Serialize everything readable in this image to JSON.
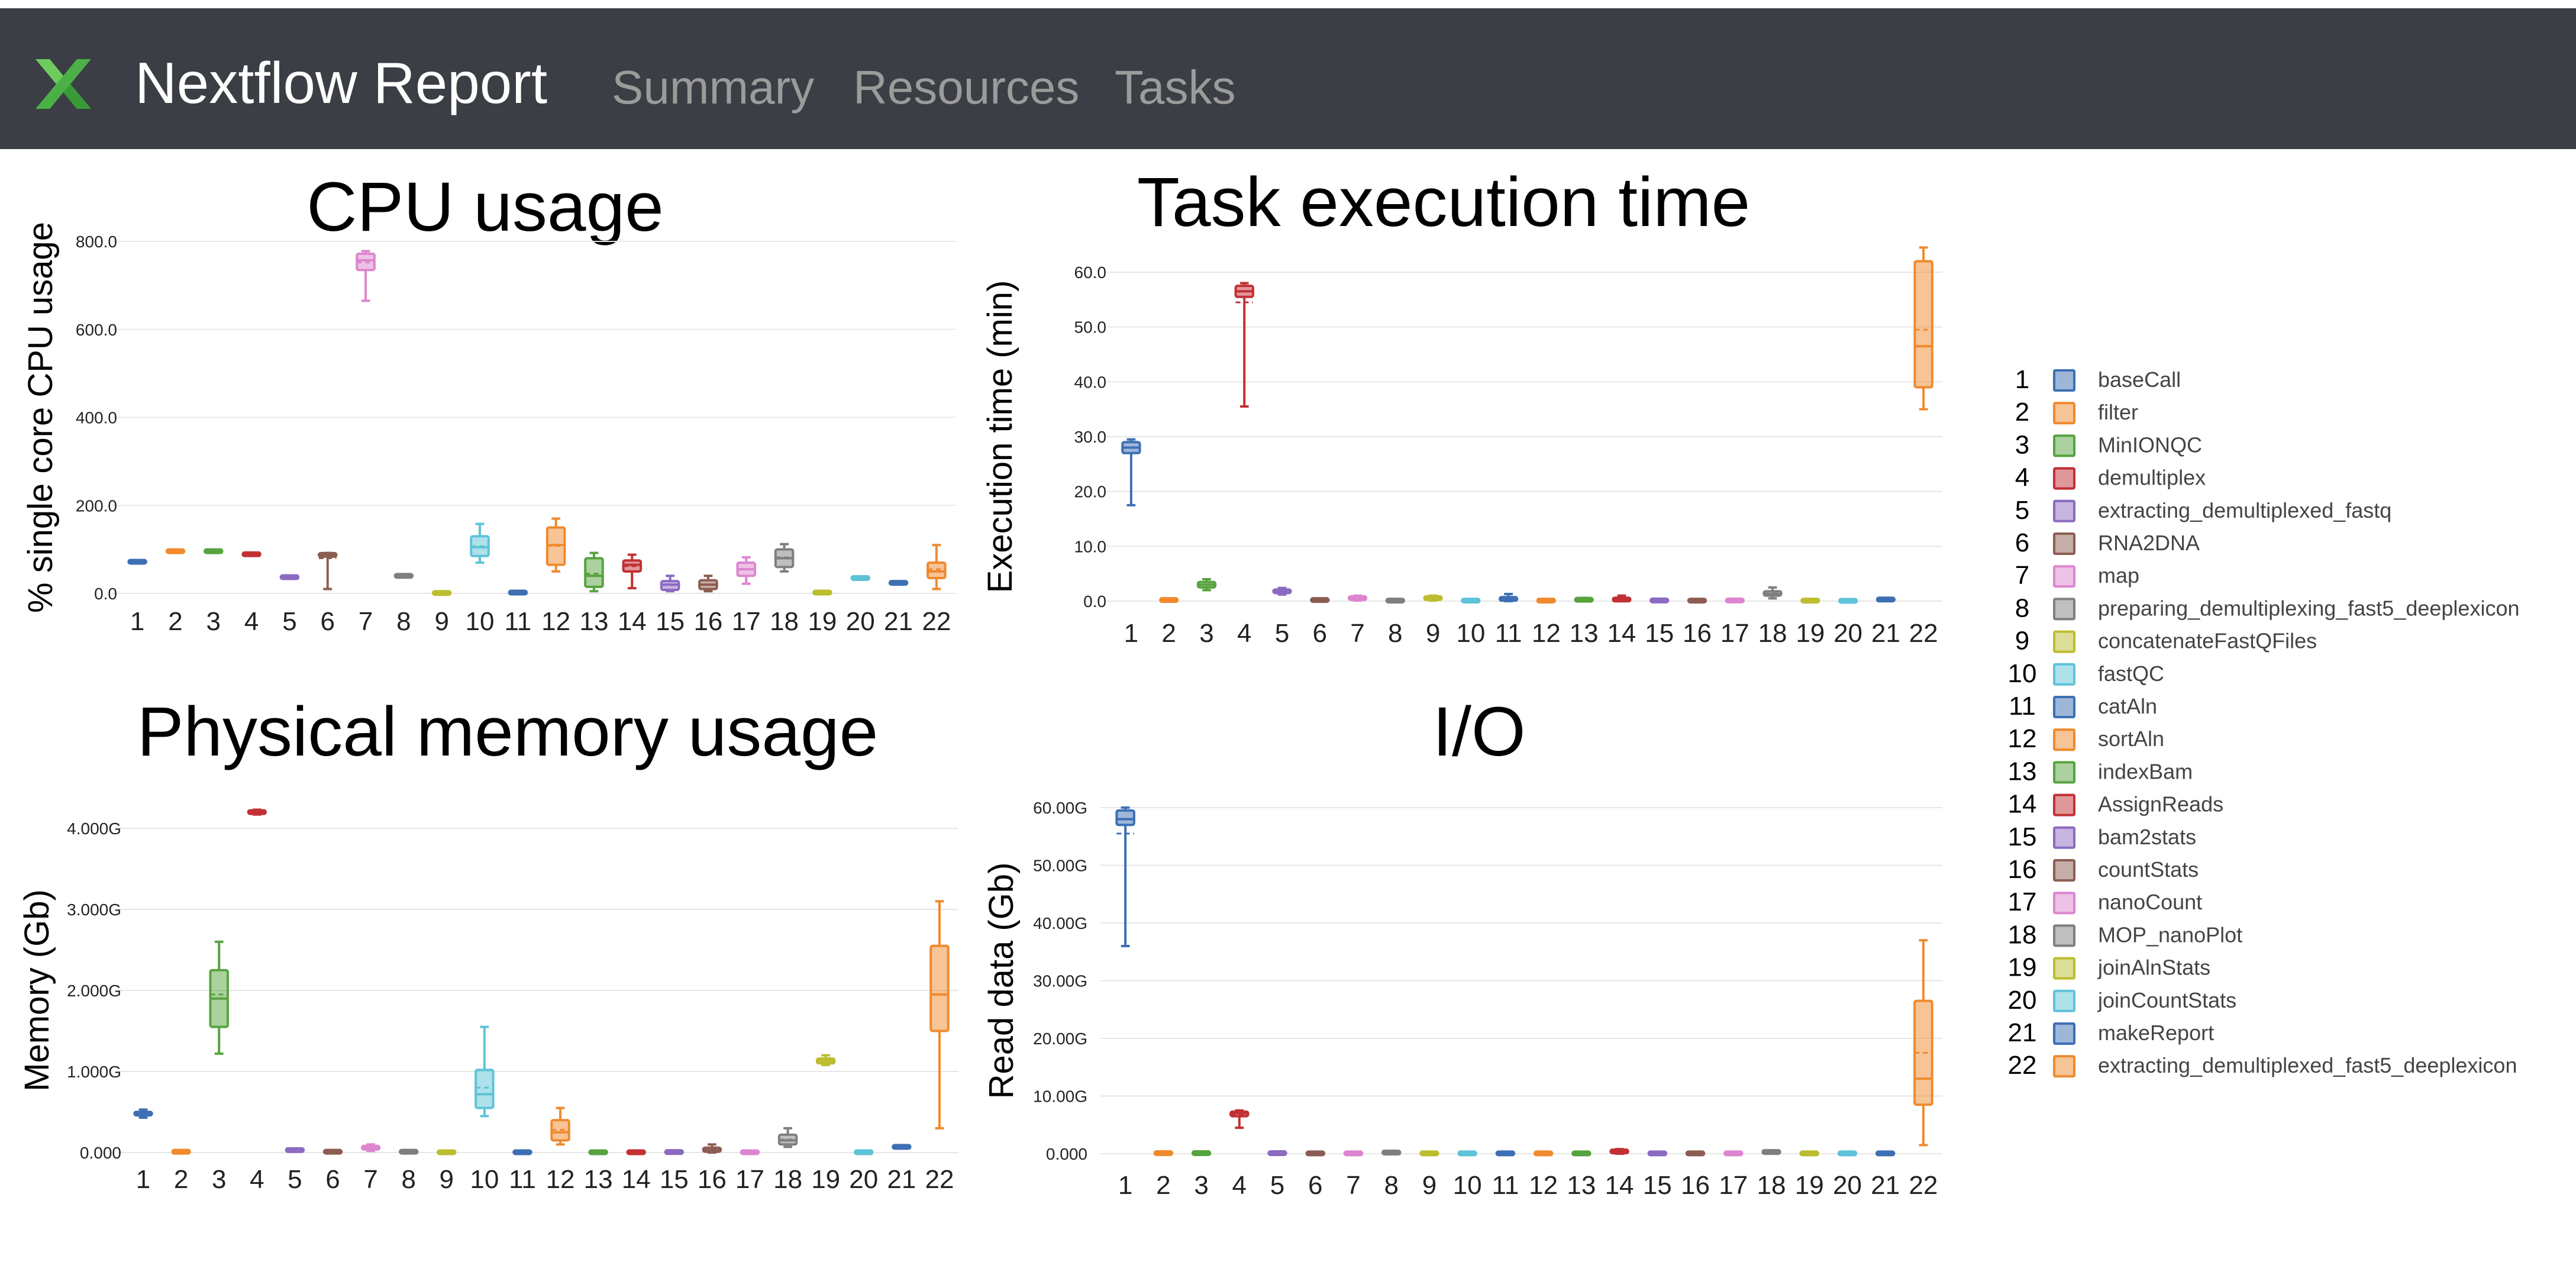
{
  "app": {
    "title": "Nextflow Report",
    "nav": [
      {
        "label": "Summary"
      },
      {
        "label": "Resources"
      },
      {
        "label": "Tasks"
      }
    ],
    "brand_color": "#4cb748",
    "navbar_color": "#3b3e44"
  },
  "legend": {
    "placement": "right",
    "items": [
      {
        "num": "1",
        "label": "baseCall",
        "color": "#3e6fb4"
      },
      {
        "num": "2",
        "label": "filter",
        "color": "#ef8a2e"
      },
      {
        "num": "3",
        "label": "MinIONQC",
        "color": "#57a33f"
      },
      {
        "num": "4",
        "label": "demultiplex",
        "color": "#c23034"
      },
      {
        "num": "5",
        "label": "extracting_demultiplexed_fastq",
        "color": "#8b6bc1"
      },
      {
        "num": "6",
        "label": "RNA2DNA",
        "color": "#8c5d52"
      },
      {
        "num": "7",
        "label": "map",
        "color": "#dd85cf"
      },
      {
        "num": "8",
        "label": "preparing_demultiplexing_fast5_deeplexicon",
        "color": "#7f7f7f"
      },
      {
        "num": "9",
        "label": "concatenateFastQFiles",
        "color": "#bcbd2f"
      },
      {
        "num": "10",
        "label": "fastQC",
        "color": "#5ec3d8"
      },
      {
        "num": "11",
        "label": "catAln",
        "color": "#3e6fb4"
      },
      {
        "num": "12",
        "label": "sortAln",
        "color": "#ef8a2e"
      },
      {
        "num": "13",
        "label": "indexBam",
        "color": "#57a33f"
      },
      {
        "num": "14",
        "label": "AssignReads",
        "color": "#c23034"
      },
      {
        "num": "15",
        "label": "bam2stats",
        "color": "#8b6bc1"
      },
      {
        "num": "16",
        "label": "countStats",
        "color": "#8c5d52"
      },
      {
        "num": "17",
        "label": "nanoCount",
        "color": "#dd85cf"
      },
      {
        "num": "18",
        "label": "MOP_nanoPlot",
        "color": "#7f7f7f"
      },
      {
        "num": "19",
        "label": "joinAlnStats",
        "color": "#bcbd2f"
      },
      {
        "num": "20",
        "label": "joinCountStats",
        "color": "#5ec3d8"
      },
      {
        "num": "21",
        "label": "makeReport",
        "color": "#3e6fb4"
      },
      {
        "num": "22",
        "label": "extracting_demultiplexed_fast5_deeplexicon",
        "color": "#ef8a2e"
      }
    ]
  },
  "chart_data": [
    {
      "id": "cpu",
      "type": "box",
      "title": "CPU usage",
      "ylabel": "% single core CPU usage",
      "ylim": [
        0,
        850
      ],
      "yticks": [
        0,
        200,
        400,
        600,
        800
      ],
      "yticklabels": [
        "0.0",
        "200.0",
        "400.0",
        "600.0",
        "800.0"
      ],
      "categories": [
        "1",
        "2",
        "3",
        "4",
        "5",
        "6",
        "7",
        "8",
        "9",
        "10",
        "11",
        "12",
        "13",
        "14",
        "15",
        "16",
        "17",
        "18",
        "19",
        "20",
        "21",
        "22"
      ],
      "boxes": [
        {
          "min": 68,
          "q1": 70,
          "median": 72,
          "q3": 74,
          "max": 76,
          "mean": 72
        },
        {
          "min": 94,
          "q1": 95,
          "median": 96,
          "q3": 97,
          "max": 98,
          "mean": 96
        },
        {
          "min": 94,
          "q1": 95,
          "median": 96,
          "q3": 97,
          "max": 98,
          "mean": 96
        },
        {
          "min": 87,
          "q1": 88,
          "median": 89,
          "q3": 90,
          "max": 91,
          "mean": 89
        },
        {
          "min": 34,
          "q1": 35,
          "median": 37,
          "q3": 39,
          "max": 40,
          "mean": 37
        },
        {
          "min": 10,
          "q1": 85,
          "median": 88,
          "q3": 90,
          "max": 92,
          "mean": 80
        },
        {
          "min": 665,
          "q1": 735,
          "median": 757,
          "q3": 772,
          "max": 778,
          "mean": 752
        },
        {
          "min": 38,
          "q1": 39,
          "median": 40,
          "q3": 41,
          "max": 42,
          "mean": 40
        },
        {
          "min": 0,
          "q1": 0,
          "median": 1,
          "q3": 2,
          "max": 3,
          "mean": 1
        },
        {
          "min": 70,
          "q1": 85,
          "median": 105,
          "q3": 130,
          "max": 158,
          "mean": 107
        },
        {
          "min": 0,
          "q1": 1,
          "median": 2,
          "q3": 3,
          "max": 4,
          "mean": 2
        },
        {
          "min": 50,
          "q1": 65,
          "median": 110,
          "q3": 150,
          "max": 170,
          "mean": 108
        },
        {
          "min": 5,
          "q1": 15,
          "median": 40,
          "q3": 80,
          "max": 92,
          "mean": 45
        },
        {
          "min": 12,
          "q1": 50,
          "median": 65,
          "q3": 75,
          "max": 88,
          "mean": 62
        },
        {
          "min": 5,
          "q1": 8,
          "median": 20,
          "q3": 28,
          "max": 40,
          "mean": 19
        },
        {
          "min": 5,
          "q1": 10,
          "median": 20,
          "q3": 30,
          "max": 40,
          "mean": 20
        },
        {
          "min": 22,
          "q1": 40,
          "median": 55,
          "q3": 70,
          "max": 82,
          "mean": 55
        },
        {
          "min": 50,
          "q1": 60,
          "median": 80,
          "q3": 100,
          "max": 112,
          "mean": 82
        },
        {
          "min": 0,
          "q1": 1,
          "median": 2,
          "q3": 3,
          "max": 4,
          "mean": 2
        },
        {
          "min": 33,
          "q1": 34,
          "median": 35,
          "q3": 36,
          "max": 37,
          "mean": 35
        },
        {
          "min": 22,
          "q1": 23,
          "median": 24,
          "q3": 25,
          "max": 26,
          "mean": 24
        },
        {
          "min": 10,
          "q1": 35,
          "median": 50,
          "q3": 70,
          "max": 110,
          "mean": 55
        }
      ]
    },
    {
      "id": "time",
      "type": "box",
      "title": "Task execution time",
      "ylabel": "Execution time (min)",
      "ylim": [
        0,
        65
      ],
      "yticks": [
        0,
        10,
        20,
        30,
        40,
        50,
        60
      ],
      "yticklabels": [
        "0.0",
        "10.0",
        "20.0",
        "30.0",
        "40.0",
        "50.0",
        "60.0"
      ],
      "categories": [
        "1",
        "2",
        "3",
        "4",
        "5",
        "6",
        "7",
        "8",
        "9",
        "10",
        "11",
        "12",
        "13",
        "14",
        "15",
        "16",
        "17",
        "18",
        "19",
        "20",
        "21",
        "22"
      ],
      "boxes": [
        {
          "min": 17.5,
          "q1": 27,
          "median": 28,
          "q3": 29,
          "max": 29.5,
          "mean": 27
        },
        {
          "min": 0,
          "q1": 0.1,
          "median": 0.2,
          "q3": 0.3,
          "max": 0.4,
          "mean": 0.2
        },
        {
          "min": 2,
          "q1": 2.5,
          "median": 3,
          "q3": 3.5,
          "max": 4,
          "mean": 3
        },
        {
          "min": 35.5,
          "q1": 55.5,
          "median": 56.5,
          "q3": 57.5,
          "max": 58,
          "mean": 54.5
        },
        {
          "min": 1.2,
          "q1": 1.5,
          "median": 1.8,
          "q3": 2.1,
          "max": 2.4,
          "mean": 1.8
        },
        {
          "min": 0,
          "q1": 0.1,
          "median": 0.2,
          "q3": 0.3,
          "max": 0.4,
          "mean": 0.2
        },
        {
          "min": 0.1,
          "q1": 0.3,
          "median": 0.5,
          "q3": 0.8,
          "max": 1,
          "mean": 0.5
        },
        {
          "min": 0,
          "q1": 0.05,
          "median": 0.1,
          "q3": 0.15,
          "max": 0.2,
          "mean": 0.1
        },
        {
          "min": 0.1,
          "q1": 0.3,
          "median": 0.5,
          "q3": 0.8,
          "max": 1,
          "mean": 0.5
        },
        {
          "min": 0,
          "q1": 0.05,
          "median": 0.1,
          "q3": 0.15,
          "max": 0.2,
          "mean": 0.1
        },
        {
          "min": 0,
          "q1": 0.1,
          "median": 0.3,
          "q3": 0.7,
          "max": 1.3,
          "mean": 0.4
        },
        {
          "min": 0,
          "q1": 0.05,
          "median": 0.1,
          "q3": 0.15,
          "max": 0.2,
          "mean": 0.1
        },
        {
          "min": 0,
          "q1": 0.1,
          "median": 0.2,
          "q3": 0.4,
          "max": 0.6,
          "mean": 0.2
        },
        {
          "min": 0,
          "q1": 0.1,
          "median": 0.2,
          "q3": 0.5,
          "max": 1,
          "mean": 0.3
        },
        {
          "min": 0,
          "q1": 0.05,
          "median": 0.1,
          "q3": 0.2,
          "max": 0.3,
          "mean": 0.1
        },
        {
          "min": 0,
          "q1": 0.05,
          "median": 0.1,
          "q3": 0.15,
          "max": 0.2,
          "mean": 0.1
        },
        {
          "min": 0,
          "q1": 0.05,
          "median": 0.1,
          "q3": 0.2,
          "max": 0.3,
          "mean": 0.1
        },
        {
          "min": 0.5,
          "q1": 1,
          "median": 1.3,
          "q3": 1.8,
          "max": 2.5,
          "mean": 1.4
        },
        {
          "min": 0,
          "q1": 0.05,
          "median": 0.1,
          "q3": 0.15,
          "max": 0.2,
          "mean": 0.1
        },
        {
          "min": 0,
          "q1": 0.03,
          "median": 0.05,
          "q3": 0.08,
          "max": 0.1,
          "mean": 0.05
        },
        {
          "min": 0.1,
          "q1": 0.2,
          "median": 0.3,
          "q3": 0.4,
          "max": 0.5,
          "mean": 0.3
        },
        {
          "min": 35,
          "q1": 39,
          "median": 46.5,
          "q3": 62,
          "max": 64.5,
          "mean": 49.5
        }
      ]
    },
    {
      "id": "memory",
      "type": "box",
      "title": "Physical memory usage",
      "ylabel": "Memory (Gb)",
      "ylim": [
        0,
        4.5
      ],
      "yticks": [
        0,
        1,
        2,
        3,
        4
      ],
      "yticklabels": [
        "0.000",
        "1.000G",
        "2.000G",
        "3.000G",
        "4.000G"
      ],
      "categories": [
        "1",
        "2",
        "3",
        "4",
        "5",
        "6",
        "7",
        "8",
        "9",
        "10",
        "11",
        "12",
        "13",
        "14",
        "15",
        "16",
        "17",
        "18",
        "19",
        "20",
        "21",
        "22"
      ],
      "boxes": [
        {
          "min": 0.43,
          "q1": 0.46,
          "median": 0.48,
          "q3": 0.5,
          "max": 0.53,
          "mean": 0.48
        },
        {
          "min": 0,
          "q1": 0.005,
          "median": 0.01,
          "q3": 0.015,
          "max": 0.02,
          "mean": 0.01
        },
        {
          "min": 1.22,
          "q1": 1.55,
          "median": 1.9,
          "q3": 2.25,
          "max": 2.6,
          "mean": 1.95
        },
        {
          "min": 4.17,
          "q1": 4.19,
          "median": 4.2,
          "q3": 4.21,
          "max": 4.23,
          "mean": 4.2
        },
        {
          "min": 0.01,
          "q1": 0.02,
          "median": 0.03,
          "q3": 0.04,
          "max": 0.05,
          "mean": 0.03
        },
        {
          "min": 0,
          "q1": 0.005,
          "median": 0.01,
          "q3": 0.015,
          "max": 0.02,
          "mean": 0.01
        },
        {
          "min": 0.02,
          "q1": 0.04,
          "median": 0.06,
          "q3": 0.08,
          "max": 0.1,
          "mean": 0.06
        },
        {
          "min": 0,
          "q1": 0.005,
          "median": 0.01,
          "q3": 0.015,
          "max": 0.02,
          "mean": 0.01
        },
        {
          "min": 0,
          "q1": 0.002,
          "median": 0.004,
          "q3": 0.006,
          "max": 0.008,
          "mean": 0.004
        },
        {
          "min": 0.45,
          "q1": 0.55,
          "median": 0.72,
          "q3": 1.02,
          "max": 1.55,
          "mean": 0.8
        },
        {
          "min": 0,
          "q1": 0.002,
          "median": 0.004,
          "q3": 0.006,
          "max": 0.008,
          "mean": 0.004
        },
        {
          "min": 0.1,
          "q1": 0.15,
          "median": 0.25,
          "q3": 0.4,
          "max": 0.55,
          "mean": 0.28
        },
        {
          "min": 0,
          "q1": 0.002,
          "median": 0.004,
          "q3": 0.006,
          "max": 0.008,
          "mean": 0.004
        },
        {
          "min": 0,
          "q1": 0.002,
          "median": 0.004,
          "q3": 0.006,
          "max": 0.008,
          "mean": 0.004
        },
        {
          "min": 0,
          "q1": 0.003,
          "median": 0.006,
          "q3": 0.009,
          "max": 0.012,
          "mean": 0.006
        },
        {
          "min": 0,
          "q1": 0.01,
          "median": 0.03,
          "q3": 0.06,
          "max": 0.1,
          "mean": 0.04
        },
        {
          "min": 0,
          "q1": 0.002,
          "median": 0.004,
          "q3": 0.006,
          "max": 0.008,
          "mean": 0.004
        },
        {
          "min": 0.07,
          "q1": 0.1,
          "median": 0.15,
          "q3": 0.22,
          "max": 0.3,
          "mean": 0.16
        },
        {
          "min": 1.08,
          "q1": 1.1,
          "median": 1.13,
          "q3": 1.16,
          "max": 1.2,
          "mean": 1.13
        },
        {
          "min": 0,
          "q1": 0.002,
          "median": 0.004,
          "q3": 0.006,
          "max": 0.008,
          "mean": 0.004
        },
        {
          "min": 0.05,
          "q1": 0.06,
          "median": 0.07,
          "q3": 0.08,
          "max": 0.09,
          "mean": 0.07
        },
        {
          "min": 0.3,
          "q1": 1.5,
          "median": 1.95,
          "q3": 2.55,
          "max": 3.1,
          "mean": 1.95
        }
      ]
    },
    {
      "id": "io",
      "type": "box",
      "title": "I/O",
      "ylabel": "Read data (Gb)",
      "ylim": [
        0,
        62
      ],
      "yticks": [
        0,
        10,
        20,
        30,
        40,
        50,
        60
      ],
      "yticklabels": [
        "0.000",
        "10.00G",
        "20.00G",
        "30.00G",
        "40.00G",
        "50.00G",
        "60.00G"
      ],
      "categories": [
        "1",
        "2",
        "3",
        "4",
        "5",
        "6",
        "7",
        "8",
        "9",
        "10",
        "11",
        "12",
        "13",
        "14",
        "15",
        "16",
        "17",
        "18",
        "19",
        "20",
        "21",
        "22"
      ],
      "boxes": [
        {
          "min": 36,
          "q1": 57,
          "median": 58,
          "q3": 59.5,
          "max": 60,
          "mean": 55.5
        },
        {
          "min": 0,
          "q1": 0.05,
          "median": 0.1,
          "q3": 0.15,
          "max": 0.2,
          "mean": 0.1
        },
        {
          "min": 0,
          "q1": 0.05,
          "median": 0.1,
          "q3": 0.15,
          "max": 0.2,
          "mean": 0.1
        },
        {
          "min": 4.5,
          "q1": 6.5,
          "median": 7,
          "q3": 7.3,
          "max": 7.5,
          "mean": 6.8
        },
        {
          "min": 0,
          "q1": 0.05,
          "median": 0.1,
          "q3": 0.15,
          "max": 0.2,
          "mean": 0.1
        },
        {
          "min": 0,
          "q1": 0.03,
          "median": 0.06,
          "q3": 0.09,
          "max": 0.12,
          "mean": 0.06
        },
        {
          "min": 0,
          "q1": 0.03,
          "median": 0.06,
          "q3": 0.09,
          "max": 0.12,
          "mean": 0.06
        },
        {
          "min": 0,
          "q1": 0.1,
          "median": 0.2,
          "q3": 0.3,
          "max": 0.4,
          "mean": 0.2
        },
        {
          "min": 0,
          "q1": 0.03,
          "median": 0.06,
          "q3": 0.09,
          "max": 0.12,
          "mean": 0.06
        },
        {
          "min": 0,
          "q1": 0.03,
          "median": 0.06,
          "q3": 0.09,
          "max": 0.12,
          "mean": 0.06
        },
        {
          "min": 0,
          "q1": 0.03,
          "median": 0.06,
          "q3": 0.09,
          "max": 0.12,
          "mean": 0.06
        },
        {
          "min": 0,
          "q1": 0.03,
          "median": 0.06,
          "q3": 0.09,
          "max": 0.12,
          "mean": 0.06
        },
        {
          "min": 0,
          "q1": 0.03,
          "median": 0.06,
          "q3": 0.09,
          "max": 0.12,
          "mean": 0.06
        },
        {
          "min": 0,
          "q1": 0.2,
          "median": 0.4,
          "q3": 0.6,
          "max": 0.8,
          "mean": 0.4
        },
        {
          "min": 0,
          "q1": 0.03,
          "median": 0.06,
          "q3": 0.09,
          "max": 0.12,
          "mean": 0.06
        },
        {
          "min": 0,
          "q1": 0.03,
          "median": 0.06,
          "q3": 0.09,
          "max": 0.12,
          "mean": 0.06
        },
        {
          "min": 0,
          "q1": 0.03,
          "median": 0.06,
          "q3": 0.09,
          "max": 0.12,
          "mean": 0.06
        },
        {
          "min": 0,
          "q1": 0.15,
          "median": 0.3,
          "q3": 0.45,
          "max": 0.6,
          "mean": 0.3
        },
        {
          "min": 0,
          "q1": 0.03,
          "median": 0.06,
          "q3": 0.09,
          "max": 0.12,
          "mean": 0.06
        },
        {
          "min": 0,
          "q1": 0.03,
          "median": 0.06,
          "q3": 0.09,
          "max": 0.12,
          "mean": 0.06
        },
        {
          "min": 0,
          "q1": 0.03,
          "median": 0.06,
          "q3": 0.09,
          "max": 0.12,
          "mean": 0.06
        },
        {
          "min": 1.5,
          "q1": 8.5,
          "median": 13,
          "q3": 26.5,
          "max": 37,
          "mean": 17.5
        }
      ]
    }
  ]
}
